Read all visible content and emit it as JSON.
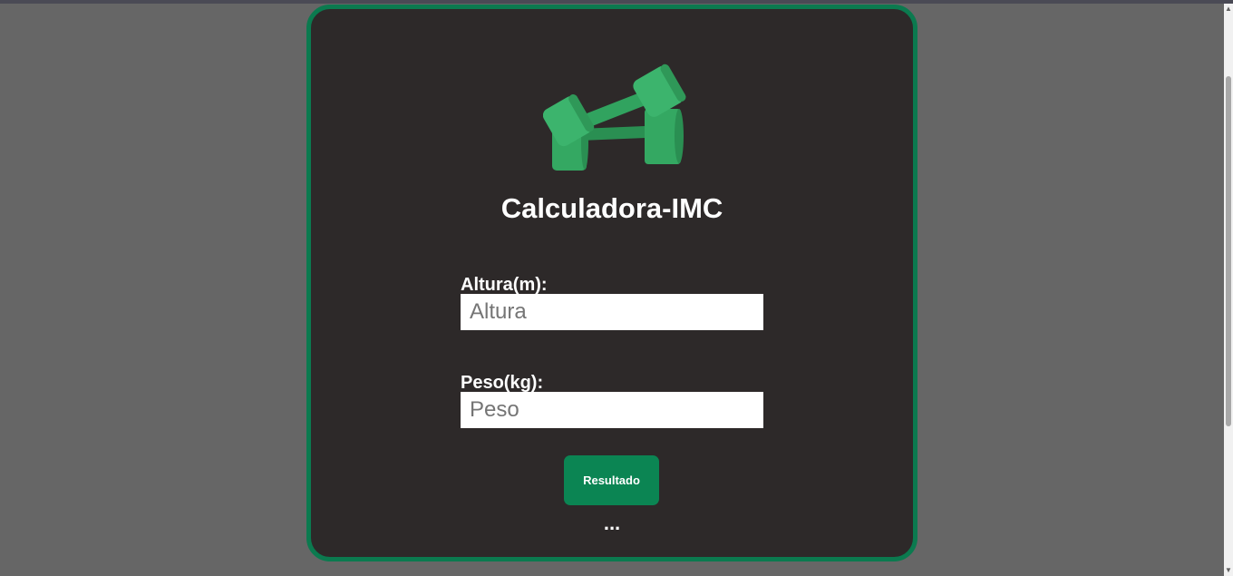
{
  "app": {
    "title": "Calculadora-IMC",
    "logo_icon": "dumbbells-icon"
  },
  "form": {
    "height": {
      "label": "Altura(m):",
      "placeholder": "Altura",
      "value": ""
    },
    "weight": {
      "label": "Peso(kg):",
      "placeholder": "Peso",
      "value": ""
    },
    "submit_label": "Resultado"
  },
  "result": {
    "text": "..."
  },
  "colors": {
    "background": "#666666",
    "card": "#2d2929",
    "accent": "#0b8553",
    "dumbbell": "#2e9d5c"
  }
}
